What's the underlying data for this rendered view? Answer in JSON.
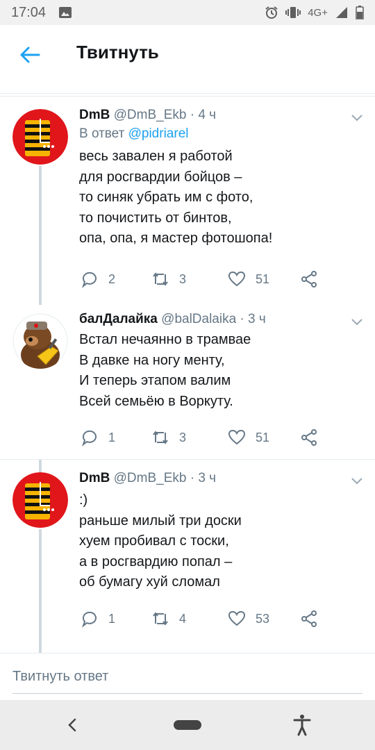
{
  "status_bar": {
    "time": "17:04",
    "network": "4G+"
  },
  "header": {
    "title": "Твитнуть"
  },
  "tweets": [
    {
      "name": "DmB",
      "handle": "@DmB_Ekb",
      "time": "· 4 ч",
      "reply_prefix": "В ответ",
      "reply_to": "@pidriarel",
      "text": "весь завален я работой\nдля росгвардии бойцов –\nто синяк убрать им с фото,\nто почистить от бинтов,\nопа, опа, я мастер фотошопа!",
      "replies": "2",
      "retweets": "3",
      "likes": "51"
    },
    {
      "name": "балДалайка",
      "handle": "@balDalaika",
      "time": "· 3 ч",
      "text": "Встал нечаянно в трамвае\nВ давке на ногу менту,\nИ теперь этапом валим\nВсей семьёю в Воркуту.",
      "replies": "1",
      "retweets": "3",
      "likes": "51"
    },
    {
      "name": "DmB",
      "handle": "@DmB_Ekb",
      "time": "· 3 ч",
      "text": ":)\nраньше милый три доски\nхуем пробивал с тоски,\nа в росгвардию попал –\nоб бумагу хуй сломал",
      "replies": "1",
      "retweets": "4",
      "likes": "53"
    }
  ],
  "reply_box": {
    "placeholder": "Твитнуть ответ"
  },
  "colors": {
    "accent": "#1da1f2",
    "secondary_text": "#657786",
    "avatar_red": "#e0161b"
  }
}
